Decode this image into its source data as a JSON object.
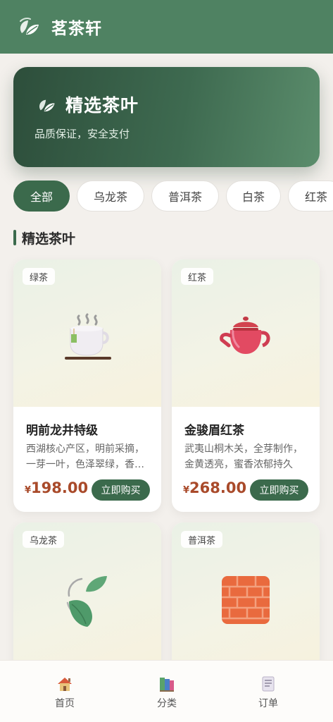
{
  "header": {
    "title": "茗茶轩",
    "logo_icon": "tea-leaf-icon"
  },
  "banner": {
    "title": "精选茶叶",
    "subtitle": "品质保证，安全支付",
    "icon": "tea-leaf-icon"
  },
  "categories": [
    {
      "label": "全部",
      "active": true
    },
    {
      "label": "乌龙茶",
      "active": false
    },
    {
      "label": "普洱茶",
      "active": false
    },
    {
      "label": "白茶",
      "active": false
    },
    {
      "label": "红茶",
      "active": false
    }
  ],
  "section": {
    "title": "精选茶叶"
  },
  "products": [
    {
      "tag": "绿茶",
      "icon": "tea-cup-icon",
      "name": "明前龙井特级",
      "desc": "西湖核心产区，明前采摘，一芽一叶，色泽翠绿，香气清高持久",
      "currency": "¥",
      "price": "198.00",
      "buy_label": "立即购买"
    },
    {
      "tag": "红茶",
      "icon": "teapot-icon",
      "name": "金骏眉红茶",
      "desc": "武夷山桐木关，全芽制作，金黄透亮，蜜香浓郁持久",
      "currency": "¥",
      "price": "268.00",
      "buy_label": "立即购买"
    },
    {
      "tag": "乌龙茶",
      "icon": "leaf-fluttering-icon"
    },
    {
      "tag": "普洱茶",
      "icon": "brick-icon"
    }
  ],
  "bottom_nav": [
    {
      "label": "首页",
      "icon": "house-icon"
    },
    {
      "label": "分类",
      "icon": "books-icon"
    },
    {
      "label": "订单",
      "icon": "receipt-icon"
    }
  ],
  "colors": {
    "primary": "#3b6a4c",
    "header": "#4f8262",
    "price": "#a94a2a",
    "background": "#f3f0ec"
  }
}
